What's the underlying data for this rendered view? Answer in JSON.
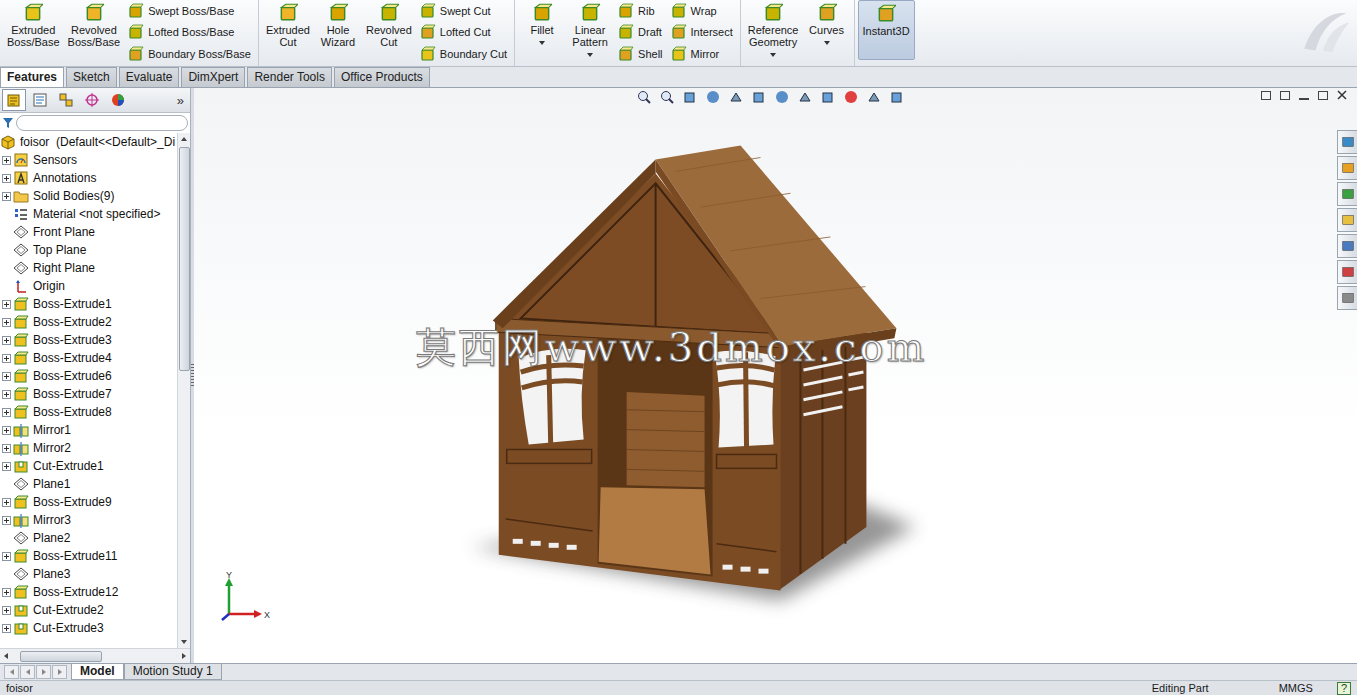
{
  "ribbon": {
    "groups": [
      {
        "items": [
          {
            "kind": "large",
            "lines": [
              "Extruded",
              "Boss/Base"
            ],
            "dropdown": false,
            "selected": false
          },
          {
            "kind": "large",
            "lines": [
              "Revolved",
              "Boss/Base"
            ],
            "dropdown": false,
            "selected": false
          },
          {
            "kind": "stack",
            "entries": [
              "Swept Boss/Base",
              "Lofted Boss/Base",
              "Boundary Boss/Base"
            ]
          }
        ]
      },
      {
        "items": [
          {
            "kind": "large",
            "lines": [
              "Extruded",
              "Cut"
            ],
            "dropdown": false,
            "selected": false
          },
          {
            "kind": "large",
            "lines": [
              "Hole",
              "Wizard"
            ],
            "dropdown": false,
            "selected": false
          },
          {
            "kind": "large",
            "lines": [
              "Revolved",
              "Cut"
            ],
            "dropdown": false,
            "selected": false
          },
          {
            "kind": "stack",
            "entries": [
              "Swept Cut",
              "Lofted Cut",
              "Boundary Cut"
            ]
          }
        ]
      },
      {
        "items": [
          {
            "kind": "large",
            "lines": [
              "Fillet"
            ],
            "dropdown": true,
            "selected": false
          },
          {
            "kind": "large",
            "lines": [
              "Linear",
              "Pattern"
            ],
            "dropdown": true,
            "selected": false
          },
          {
            "kind": "stack",
            "entries": [
              "Rib",
              "Draft",
              "Shell"
            ]
          },
          {
            "kind": "stack",
            "entries": [
              "Wrap",
              "Intersect",
              "Mirror"
            ]
          }
        ]
      },
      {
        "items": [
          {
            "kind": "large",
            "lines": [
              "Reference",
              "Geometry"
            ],
            "dropdown": true,
            "selected": false
          },
          {
            "kind": "large",
            "lines": [
              "Curves"
            ],
            "dropdown": true,
            "selected": false
          }
        ]
      },
      {
        "items": [
          {
            "kind": "large",
            "lines": [
              "Instant3D"
            ],
            "dropdown": false,
            "selected": true
          }
        ]
      }
    ]
  },
  "command_tabs": [
    {
      "label": "Features",
      "selected": true
    },
    {
      "label": "Sketch",
      "selected": false
    },
    {
      "label": "Evaluate",
      "selected": false
    },
    {
      "label": "DimXpert",
      "selected": false
    },
    {
      "label": "Render Tools",
      "selected": false
    },
    {
      "label": "Office Products",
      "selected": false
    }
  ],
  "feature_manager": {
    "more": "»",
    "root": "foisor  (Default<<Default>_Di",
    "items": [
      {
        "label": "Sensors",
        "kind": "sensor",
        "expandable": true
      },
      {
        "label": "Annotations",
        "kind": "annotation",
        "expandable": true
      },
      {
        "label": "Solid Bodies(9)",
        "kind": "folder",
        "expandable": true
      },
      {
        "label": "Material <not specified>",
        "kind": "material",
        "expandable": false
      },
      {
        "label": "Front Plane",
        "kind": "plane",
        "expandable": false
      },
      {
        "label": "Top Plane",
        "kind": "plane",
        "expandable": false
      },
      {
        "label": "Right Plane",
        "kind": "plane",
        "expandable": false
      },
      {
        "label": "Origin",
        "kind": "origin",
        "expandable": false
      },
      {
        "label": "Boss-Extrude1",
        "kind": "extrude",
        "expandable": true
      },
      {
        "label": "Boss-Extrude2",
        "kind": "extrude",
        "expandable": true
      },
      {
        "label": "Boss-Extrude3",
        "kind": "extrude",
        "expandable": true
      },
      {
        "label": "Boss-Extrude4",
        "kind": "extrude",
        "expandable": true
      },
      {
        "label": "Boss-Extrude6",
        "kind": "extrude",
        "expandable": true
      },
      {
        "label": "Boss-Extrude7",
        "kind": "extrude",
        "expandable": true
      },
      {
        "label": "Boss-Extrude8",
        "kind": "extrude",
        "expandable": true
      },
      {
        "label": "Mirror1",
        "kind": "mirror",
        "expandable": true
      },
      {
        "label": "Mirror2",
        "kind": "mirror",
        "expandable": true
      },
      {
        "label": "Cut-Extrude1",
        "kind": "cut",
        "expandable": true
      },
      {
        "label": "Plane1",
        "kind": "plane",
        "expandable": false
      },
      {
        "label": "Boss-Extrude9",
        "kind": "extrude",
        "expandable": true
      },
      {
        "label": "Mirror3",
        "kind": "mirror",
        "expandable": true
      },
      {
        "label": "Plane2",
        "kind": "plane",
        "expandable": false
      },
      {
        "label": "Boss-Extrude11",
        "kind": "extrude",
        "expandable": true
      },
      {
        "label": "Plane3",
        "kind": "plane",
        "expandable": false
      },
      {
        "label": "Boss-Extrude12",
        "kind": "extrude",
        "expandable": true
      },
      {
        "label": "Cut-Extrude2",
        "kind": "cut",
        "expandable": true
      },
      {
        "label": "Cut-Extrude3",
        "kind": "cut",
        "expandable": true
      }
    ]
  },
  "viewport": {
    "watermark": "莫西网www.3dmox.com",
    "triad": {
      "y_label": "Y",
      "x_label": "X"
    }
  },
  "bottom_tabs": [
    {
      "label": "Model",
      "selected": true
    },
    {
      "label": "Motion Study 1",
      "selected": false
    }
  ],
  "status_bar": {
    "document": "foisor",
    "mode": "Editing Part",
    "units": "MMGS",
    "help": "?"
  }
}
